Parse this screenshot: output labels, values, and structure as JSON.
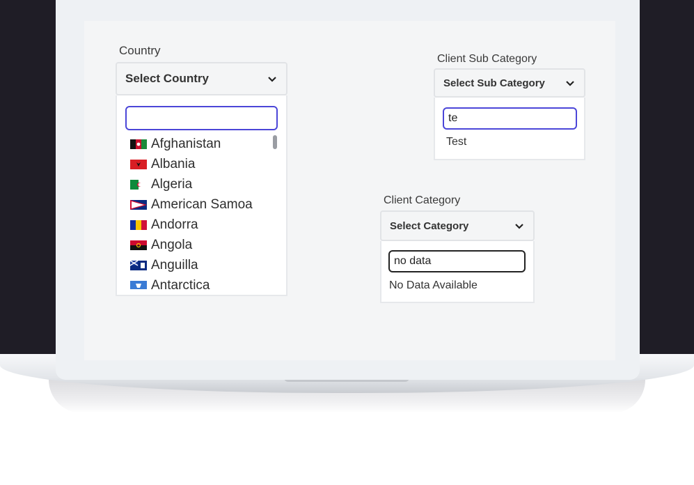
{
  "country": {
    "label": "Country",
    "select_text": "Select Country",
    "search_value": "",
    "options": [
      "Afghanistan",
      "Albania",
      "Algeria",
      "American Samoa",
      "Andorra",
      "Angola",
      "Anguilla",
      "Antarctica"
    ]
  },
  "sub_category": {
    "label": "Client Sub Category",
    "select_text": "Select Sub Category",
    "search_value": "te",
    "results": [
      "Test"
    ]
  },
  "category": {
    "label": "Client Category",
    "select_text": "Select Category",
    "search_value": "no data",
    "empty_text": "No Data Available"
  },
  "colors": {
    "backdrop": "#1f1d26",
    "focus_border": "#4b46d8",
    "dark_border": "#222222"
  }
}
